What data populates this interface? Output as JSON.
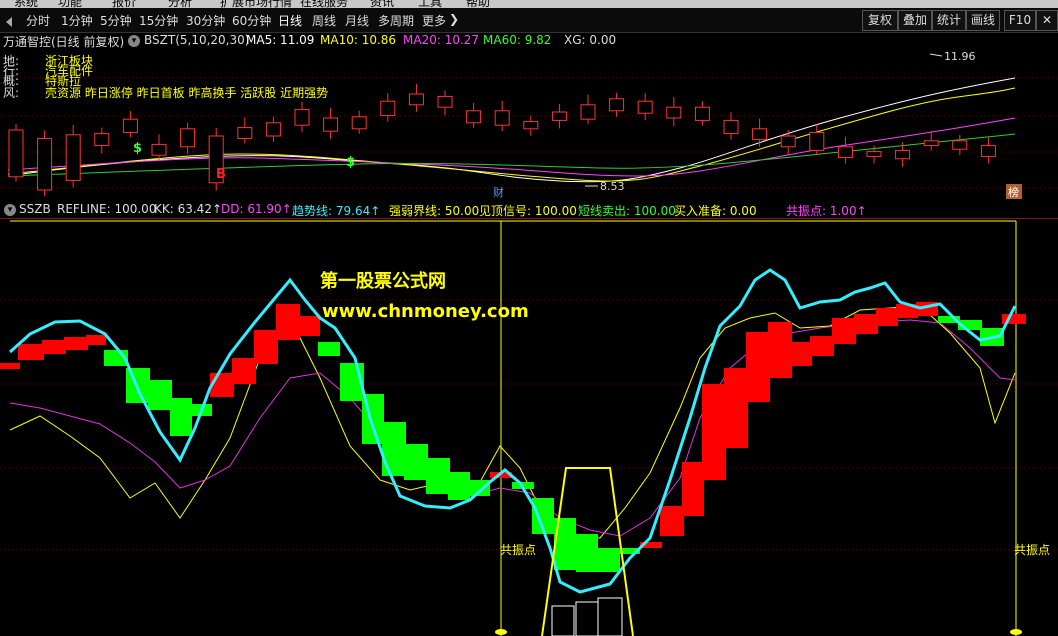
{
  "menu": [
    "系统",
    "功能",
    "报价",
    "分析",
    "扩展市场行情",
    "在线服务",
    "资讯",
    "工具",
    "帮助"
  ],
  "periods": [
    {
      "label": "分时",
      "active": false
    },
    {
      "label": "1分钟",
      "active": false
    },
    {
      "label": "5分钟",
      "active": false
    },
    {
      "label": "15分钟",
      "active": false
    },
    {
      "label": "30分钟",
      "active": false
    },
    {
      "label": "60分钟",
      "active": false
    },
    {
      "label": "日线",
      "active": true
    },
    {
      "label": "周线",
      "active": false
    },
    {
      "label": "月线",
      "active": false
    },
    {
      "label": "多周期",
      "active": false
    },
    {
      "label": "更多",
      "active": false
    }
  ],
  "toolbar_right": [
    "复权",
    "叠加",
    "统计",
    "画线",
    "F10"
  ],
  "main_chart": {
    "title": "万通智控(日线 前复权)",
    "indicator": "BSZT(5,10,20,30)",
    "ma": [
      {
        "label": "MA5: 11.09",
        "color": "#ffffff"
      },
      {
        "label": "MA10: 10.86",
        "color": "#ffff00"
      },
      {
        "label": "MA20: 10.27",
        "color": "#ff44ff"
      },
      {
        "label": "MA60: 9.82",
        "color": "#33ff33"
      },
      {
        "label": "XG: 0.00",
        "color": "#dddddd"
      }
    ],
    "info_lines": [
      {
        "key": "地:",
        "value": "浙江板块"
      },
      {
        "key": "行:",
        "value": "汽车配件"
      },
      {
        "key": "概:",
        "value": "特斯拉"
      },
      {
        "key": "风:",
        "value": "壳资源 昨日涨停 昨日首板 昨高换手 活跃股 近期强势"
      }
    ],
    "high_label": "11.96",
    "low_label": "8.53",
    "markers": {
      "buy": "B",
      "dollar": "$",
      "cai": "财",
      "bang": "榜"
    }
  },
  "indicator_panel": {
    "name": "SSZB",
    "items": [
      {
        "label": "REFLINE: 100.00",
        "color": "#dddddd"
      },
      {
        "label": "KK: 63.42↑",
        "color": "#dddddd"
      },
      {
        "label": "DD: 61.90↑",
        "color": "#ff44ff"
      },
      {
        "label": "趋势线: 79.64↑",
        "color": "#33eeff"
      },
      {
        "label": "强弱界线: 50.00",
        "color": "#ffff00"
      },
      {
        "label": "见顶信号: 100.00",
        "color": "#ffff00"
      },
      {
        "label": "短线卖出: 100.00",
        "color": "#33ff33"
      },
      {
        "label": "买入准备: 0.00",
        "color": "#ffff00"
      },
      {
        "label": "共振点: 1.00↑",
        "color": "#ff44ff"
      }
    ],
    "resonance_label": "共振点",
    "watermark_title": "第一股票公式网",
    "watermark_url": "www.chnmoney.com"
  },
  "candles": [
    [
      5.6,
      9.5
    ],
    [
      4.5,
      8.8
    ],
    [
      5.3,
      9.1
    ],
    [
      8.2,
      9.2
    ],
    [
      9.3,
      10.4
    ],
    [
      7.4,
      8.3
    ],
    [
      8.1,
      9.6
    ],
    [
      5.1,
      9.0
    ],
    [
      8.8,
      9.7
    ],
    [
      9.0,
      10.1
    ],
    [
      9.9,
      11.2
    ],
    [
      9.4,
      10.5
    ],
    [
      9.6,
      10.6
    ],
    [
      10.7,
      11.9
    ],
    [
      11.6,
      12.5
    ],
    [
      11.4,
      12.3
    ],
    [
      10.1,
      11.1
    ],
    [
      9.9,
      11.1
    ],
    [
      9.6,
      10.2
    ],
    [
      10.3,
      11.0
    ],
    [
      10.4,
      11.6
    ],
    [
      11.1,
      12.1
    ],
    [
      10.9,
      11.9
    ],
    [
      10.5,
      11.4
    ],
    [
      10.3,
      11.4
    ],
    [
      9.2,
      10.3
    ],
    [
      8.7,
      9.6
    ],
    [
      8.1,
      9.0
    ],
    [
      7.8,
      9.3
    ],
    [
      7.2,
      8.1
    ],
    [
      7.3,
      7.7
    ],
    [
      7.1,
      7.8
    ],
    [
      8.2,
      8.6
    ],
    [
      7.9,
      8.6
    ],
    [
      7.3,
      8.2
    ]
  ]
}
